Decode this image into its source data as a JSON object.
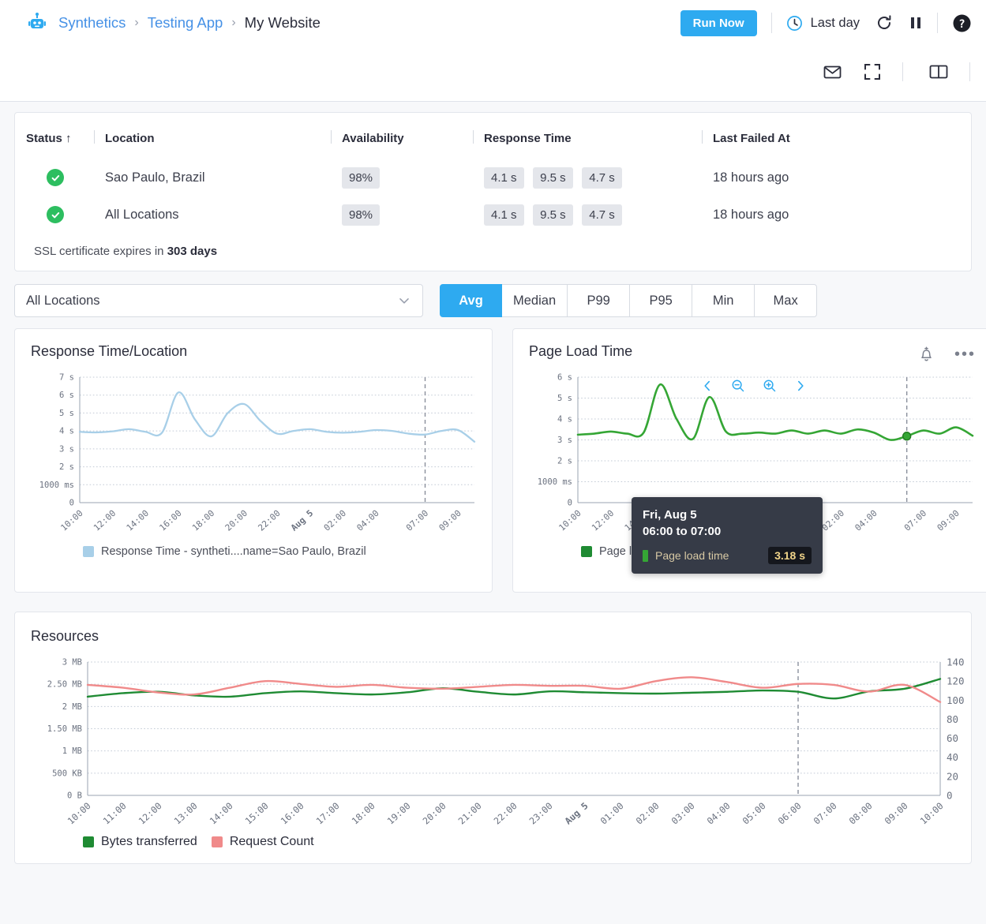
{
  "header": {
    "logo_icon": "synthetics-robot-icon",
    "breadcrumb": [
      {
        "label": "Synthetics",
        "current": false
      },
      {
        "label": "Testing App",
        "current": false
      },
      {
        "label": "My Website",
        "current": true
      }
    ],
    "separator": "›",
    "run_now_label": "Run Now",
    "time_range_label": "Last day",
    "clock_icon": "clock-icon",
    "refresh_icon": "refresh-icon",
    "pause_icon": "pause-icon",
    "help_icon": "help-circle-icon",
    "mail_icon": "mail-icon",
    "fullscreen_icon": "fullscreen-icon",
    "layout_icon": "split-layout-icon"
  },
  "summary": {
    "columns": [
      "Status ↑",
      "Location",
      "Availability",
      "Response Time",
      "Last Failed At"
    ],
    "rows": [
      {
        "status": "ok",
        "status_icon": "check-circle-icon",
        "location": "Sao Paulo, Brazil",
        "availability": "98%",
        "response_times": [
          "4.1 s",
          "9.5 s",
          "4.7 s"
        ],
        "last_failed_at": "18 hours ago"
      },
      {
        "status": "ok",
        "status_icon": "check-circle-icon",
        "location": "All Locations",
        "availability": "98%",
        "response_times": [
          "4.1 s",
          "9.5 s",
          "4.7 s"
        ],
        "last_failed_at": "18 hours ago"
      }
    ],
    "ssl_prefix": "SSL certificate expires in ",
    "ssl_days": "303 days"
  },
  "filters": {
    "location_value": "All Locations",
    "chevron_icon": "chevron-down-icon",
    "aggregations": [
      "Avg",
      "Median",
      "P99",
      "P95",
      "Min",
      "Max"
    ],
    "active_aggregation": "Avg"
  },
  "colors": {
    "accent": "#2eaaf0",
    "link": "#4691e6",
    "ok_green": "#2dbe60",
    "response_blue": "#a8cfe8",
    "page_load_green": "#35a635",
    "bytes_green": "#1f8b33",
    "request_pink": "#f08a8a",
    "tooltip_bg": "#363b47"
  },
  "chart_data": [
    {
      "type": "line",
      "title": "Response Time/Location",
      "xlabel": "",
      "ylabel": "",
      "ylim": [
        0,
        7
      ],
      "ytick_labels": [
        "7 s",
        "6 s",
        "5 s",
        "4 s",
        "3 s",
        "2 s",
        "1000 ms",
        "0"
      ],
      "ytick_values": [
        7,
        6,
        5,
        4,
        3,
        2,
        1,
        0
      ],
      "grid": true,
      "legend_position": "bottom",
      "marker_line": "07:00",
      "x": [
        "10:00",
        "11:00",
        "12:00",
        "13:00",
        "14:00",
        "15:00",
        "16:00",
        "17:00",
        "18:00",
        "19:00",
        "20:00",
        "21:00",
        "22:00",
        "23:00",
        "Aug 5",
        "01:00",
        "02:00",
        "03:00",
        "04:00",
        "05:00",
        "06:00",
        "07:00",
        "08:00",
        "09:00",
        "10:00"
      ],
      "xtick_labels": [
        "10:00",
        "12:00",
        "14:00",
        "16:00",
        "18:00",
        "20:00",
        "22:00",
        "Aug 5",
        "02:00",
        "04:00",
        "07:00",
        "09:00"
      ],
      "series": [
        {
          "name": "Response Time - syntheti....name=Sao Paulo, Brazil",
          "color": "#a8cfe8",
          "values": [
            3.95,
            3.92,
            3.98,
            4.1,
            3.95,
            3.9,
            6.15,
            4.65,
            3.7,
            5.0,
            5.5,
            4.55,
            3.85,
            4.0,
            4.1,
            3.95,
            3.9,
            3.95,
            4.05,
            4.0,
            3.85,
            3.8,
            4.0,
            4.05,
            3.4
          ]
        }
      ]
    },
    {
      "type": "line",
      "title": "Page Load Time",
      "xlabel": "",
      "ylabel": "",
      "ylim": [
        0,
        6
      ],
      "ytick_labels": [
        "6 s",
        "5 s",
        "4 s",
        "3 s",
        "2 s",
        "1000 ms",
        "0"
      ],
      "ytick_values": [
        6,
        5,
        4,
        3,
        2,
        1,
        0
      ],
      "grid": true,
      "legend_position": "bottom",
      "marker_line": "06:00",
      "highlight_point": {
        "x": "06:00",
        "y": 3.18
      },
      "x": [
        "10:00",
        "11:00",
        "12:00",
        "13:00",
        "14:00",
        "15:00",
        "16:00",
        "17:00",
        "18:00",
        "19:00",
        "20:00",
        "21:00",
        "22:00",
        "23:00",
        "Aug 5",
        "01:00",
        "02:00",
        "03:00",
        "04:00",
        "05:00",
        "06:00",
        "07:00",
        "08:00",
        "09:00",
        "10:00"
      ],
      "xtick_labels": [
        "10:00",
        "12:00",
        "14:00",
        "16:00",
        "18:00",
        "20:00",
        "22:00",
        "Aug 5",
        "02:00",
        "04:00",
        "07:00",
        "09:00"
      ],
      "series": [
        {
          "name": "Page load time",
          "color": "#35a635",
          "values": [
            3.25,
            3.3,
            3.4,
            3.3,
            3.35,
            5.65,
            4.0,
            3.05,
            5.05,
            3.4,
            3.3,
            3.35,
            3.3,
            3.45,
            3.3,
            3.45,
            3.3,
            3.5,
            3.35,
            3.0,
            3.18,
            3.45,
            3.3,
            3.6,
            3.2
          ]
        }
      ],
      "navigation": {
        "prev_icon": "chevron-left-icon",
        "zoom_out_icon": "zoom-out-icon",
        "zoom_in_icon": "zoom-in-icon",
        "next_icon": "chevron-right-icon"
      },
      "alert_icon": "bell-add-icon",
      "more_icon": "more-options-icon",
      "tooltip": {
        "date": "Fri, Aug 5",
        "time_range": "06:00 to 07:00",
        "metric": "Page load time",
        "value": "3.18 s"
      }
    },
    {
      "type": "line",
      "title": "Resources",
      "xlabel": "",
      "grid": true,
      "legend_position": "bottom",
      "marker_line": "06:00",
      "left_axis": {
        "label": "",
        "ytick_labels": [
          "3 MB",
          "2.50 MB",
          "2 MB",
          "1.50 MB",
          "1 MB",
          "500 KB",
          "0 B"
        ],
        "ytick_values": [
          3,
          2.5,
          2,
          1.5,
          1,
          0.5,
          0
        ],
        "ylim": [
          0,
          3
        ]
      },
      "right_axis": {
        "label": "",
        "ytick_labels": [
          "140",
          "120",
          "100",
          "80",
          "60",
          "40",
          "20",
          "0"
        ],
        "ytick_values": [
          140,
          120,
          100,
          80,
          60,
          40,
          20,
          0
        ],
        "ylim": [
          0,
          140
        ]
      },
      "x": [
        "10:00",
        "11:00",
        "12:00",
        "13:00",
        "14:00",
        "15:00",
        "16:00",
        "17:00",
        "18:00",
        "19:00",
        "20:00",
        "21:00",
        "22:00",
        "23:00",
        "Aug 5",
        "01:00",
        "02:00",
        "03:00",
        "04:00",
        "05:00",
        "06:00",
        "07:00",
        "08:00",
        "09:00",
        "10:00"
      ],
      "xtick_labels": [
        "10:00",
        "11:00",
        "12:00",
        "13:00",
        "14:00",
        "15:00",
        "16:00",
        "17:00",
        "18:00",
        "19:00",
        "20:00",
        "21:00",
        "22:00",
        "23:00",
        "Aug 5",
        "01:00",
        "02:00",
        "03:00",
        "04:00",
        "05:00",
        "06:00",
        "07:00",
        "08:00",
        "09:00",
        "10:00"
      ],
      "series": [
        {
          "name": "Bytes transferred",
          "axis": "left",
          "color": "#1f8b33",
          "values": [
            2.22,
            2.3,
            2.33,
            2.25,
            2.22,
            2.3,
            2.34,
            2.3,
            2.27,
            2.32,
            2.41,
            2.33,
            2.27,
            2.34,
            2.32,
            2.3,
            2.29,
            2.31,
            2.33,
            2.36,
            2.33,
            2.18,
            2.34,
            2.4,
            2.62
          ]
        },
        {
          "name": "Request Count",
          "axis": "right",
          "color": "#f08a8a",
          "values": [
            116,
            113,
            108,
            106,
            113,
            120,
            117,
            114,
            116,
            113,
            112,
            114,
            116,
            115,
            115,
            112,
            120,
            124,
            119,
            113,
            117,
            116,
            109,
            116,
            98
          ]
        }
      ]
    }
  ]
}
